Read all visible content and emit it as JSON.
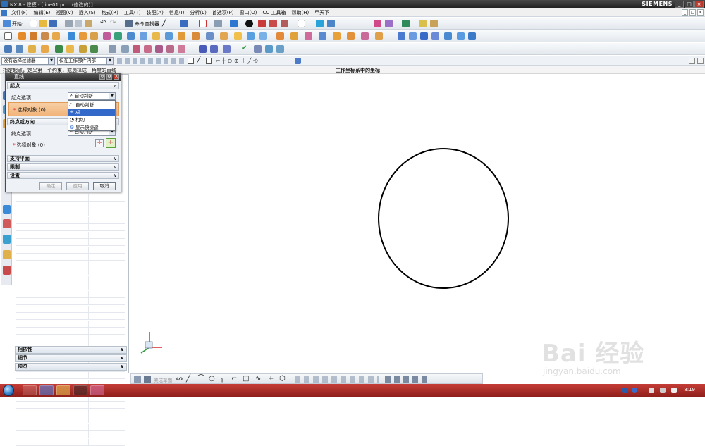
{
  "window": {
    "title": "NX 8 - 建模 - [line01.prt （修改的）]",
    "brand": "SIEMENS"
  },
  "menu": {
    "items": [
      "文件(F)",
      "编辑(E)",
      "视图(V)",
      "插入(S)",
      "格式(R)",
      "工具(T)",
      "装配(A)",
      "信息(I)",
      "分析(L)",
      "首选项(P)",
      "窗口(O)",
      "CC 工具箱",
      "帮助(H)",
      "甲天下"
    ]
  },
  "toolbar": {
    "start_label": "开始·",
    "command_finder_label": "命令查找器"
  },
  "selection_bar": {
    "filter": "没有选择过滤器",
    "scope": "仅在工作部件内部"
  },
  "hint": {
    "prompt": "指定起点，定义第一个约束，或选择成一角度的直线",
    "status": "工作坐标系中的坐标"
  },
  "dialog": {
    "title": "直线",
    "start_section": "起点",
    "start_option_label": "起点选项",
    "start_option_value": "自动判断",
    "select_object_1": "选择对象 (0)",
    "end_section": "终点或方向",
    "end_option_label": "终点选项",
    "end_option_value": "自动判断",
    "select_object_2": "选择对象 (0)",
    "support_plane": "支持平面",
    "limits": "限制",
    "settings": "设置",
    "ok": "确定",
    "apply": "应用",
    "cancel": "取消"
  },
  "dropdown": {
    "options": [
      "自动判断",
      "点",
      "相切",
      "显示快捷键"
    ],
    "highlighted_index": 1
  },
  "navigator": {
    "sections": [
      "相依性",
      "细节",
      "预览"
    ]
  },
  "bottom_toolbar": {
    "finish_sketch_label": "完成草图"
  },
  "taskbar": {
    "clock": "8:19"
  },
  "watermark": {
    "logo": "Bai 经验",
    "url": "jingyan.baidu.com"
  },
  "colors": {
    "accent_highlight": "#3369c9",
    "selection_active": "#f1b47a",
    "taskbar": "#b33029"
  }
}
